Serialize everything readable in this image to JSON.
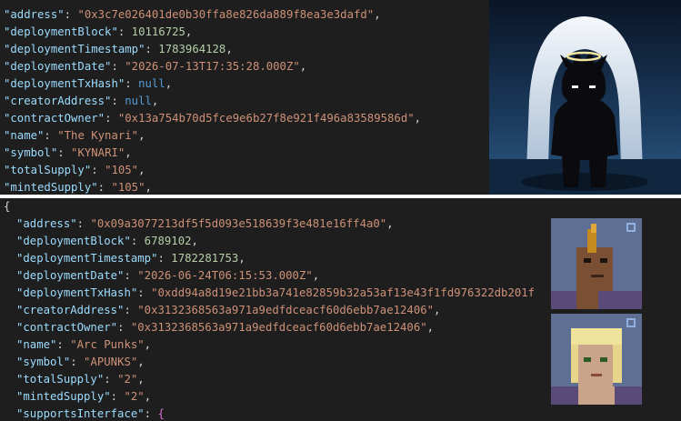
{
  "top_json": [
    {
      "key": "\"address\"",
      "value": "\"0x3c7e026401de0b30ffa8e826da889f8ea3e3dafd\"",
      "type": "string",
      "trail": ","
    },
    {
      "key": "\"deploymentBlock\"",
      "value": "10116725",
      "type": "number",
      "trail": ","
    },
    {
      "key": "\"deploymentTimestamp\"",
      "value": "1783964128",
      "type": "number",
      "trail": ","
    },
    {
      "key": "\"deploymentDate\"",
      "value": "\"2026-07-13T17:35:28.000Z\"",
      "type": "string",
      "trail": ","
    },
    {
      "key": "\"deploymentTxHash\"",
      "value": "null",
      "type": "keyword",
      "trail": ","
    },
    {
      "key": "\"creatorAddress\"",
      "value": "null",
      "type": "keyword",
      "trail": ","
    },
    {
      "key": "\"contractOwner\"",
      "value": "\"0x13a754b70d5fce9e6b27f8e921f496a83589586d\"",
      "type": "string",
      "trail": ","
    },
    {
      "key": "\"name\"",
      "value": "\"The Kynari\"",
      "type": "string",
      "trail": ","
    },
    {
      "key": "\"symbol\"",
      "value": "\"KYNARI\"",
      "type": "string",
      "trail": ","
    },
    {
      "key": "\"totalSupply\"",
      "value": "\"105\"",
      "type": "string",
      "trail": ","
    },
    {
      "key": "\"mintedSupply\"",
      "value": "\"105\"",
      "type": "string",
      "trail": ","
    }
  ],
  "bottom_open_brace": "{",
  "bottom_json": [
    {
      "key": "\"address\"",
      "value": "\"0x09a3077213df5f5d093e518639f3e481e16ff4a0\"",
      "type": "string",
      "trail": ","
    },
    {
      "key": "\"deploymentBlock\"",
      "value": "6789102",
      "type": "number",
      "trail": ","
    },
    {
      "key": "\"deploymentTimestamp\"",
      "value": "1782281753",
      "type": "number",
      "trail": ","
    },
    {
      "key": "\"deploymentDate\"",
      "value": "\"2026-06-24T06:15:53.000Z\"",
      "type": "string",
      "trail": ","
    },
    {
      "key": "\"deploymentTxHash\"",
      "value": "\"0xdd94a8d19e21bb3a741e82859b32a53af13e43f1fd976322db201f",
      "type": "string",
      "trail": ""
    },
    {
      "key": "\"creatorAddress\"",
      "value": "\"0x3132368563a971a9edfdceacf60d6ebb7ae12406\"",
      "type": "string",
      "trail": ","
    },
    {
      "key": "\"contractOwner\"",
      "value": "\"0x3132368563a971a9edfdceacf60d6ebb7ae12406\"",
      "type": "string",
      "trail": ","
    },
    {
      "key": "\"name\"",
      "value": "\"Arc Punks\"",
      "type": "string",
      "trail": ","
    },
    {
      "key": "\"symbol\"",
      "value": "\"APUNKS\"",
      "type": "string",
      "trail": ","
    },
    {
      "key": "\"totalSupply\"",
      "value": "\"2\"",
      "type": "string",
      "trail": ","
    },
    {
      "key": "\"mintedSupply\"",
      "value": "\"2\"",
      "type": "string",
      "trail": ","
    },
    {
      "key": "\"supportsInterface\"",
      "value": "{",
      "type": "brace",
      "trail": ""
    }
  ],
  "images": {
    "top": "kynari-silhouette-art",
    "bottom_1": "arc-punk-mohawk-art",
    "bottom_2": "arc-punk-blonde-art"
  },
  "colors": {
    "background": "#1e1e1e",
    "key": "#9cdcfe",
    "string": "#ce9178",
    "number": "#b5cea8",
    "keyword": "#569cd6",
    "punctuation": "#d4d4d4",
    "brace": "#da70d6"
  }
}
